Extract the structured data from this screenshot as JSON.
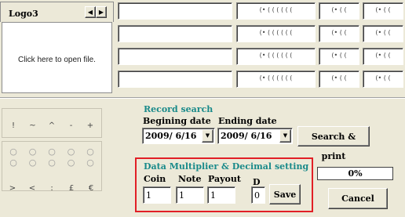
{
  "logo_tab": {
    "label": "Logo3",
    "prev_icon": "caret-left-icon",
    "next_icon": "caret-right-icon",
    "open_file_text": "Click here to open file."
  },
  "file_rows": [
    {
      "value": "",
      "radios_a": "(• ( ( ( ( ( (",
      "radios_b": "(• ( (",
      "radios_c": "(• ( ("
    },
    {
      "value": "",
      "radios_a": "(• ( ( ( ( ( (",
      "radios_b": "(• ( (",
      "radios_c": "(• ( ("
    },
    {
      "value": "",
      "radios_a": "(• ( ( ( ( ( (",
      "radios_b": "(• ( (",
      "radios_c": "(• ( ("
    },
    {
      "value": "",
      "radios_a": "(• ( ( ( ( ( (",
      "radios_b": "(• ( (",
      "radios_c": "(• ( ("
    }
  ],
  "symbols": {
    "row1": [
      "!",
      "~",
      "^",
      "-",
      "+"
    ],
    "row2": [
      "○",
      "○",
      "○",
      "○",
      "○"
    ],
    "row3": [
      "○",
      "○",
      "○",
      "○",
      "○"
    ],
    "row4": [
      ">",
      "<",
      ":",
      "£",
      "€"
    ]
  },
  "record_search": {
    "title": "Record search",
    "begin_label": "Begining date",
    "end_label": "Ending date",
    "begin_value": "2009/ 6/16",
    "end_value": "2009/ 6/16",
    "dropdown_icon": "triangle-down-icon",
    "search_print_label": "Search & print"
  },
  "data_multiplier": {
    "title": "Data Multiplier  &  Decimal setting",
    "coin_label": "Coin",
    "note_label": "Note",
    "payout_label": "Payout",
    "d_label": "D",
    "coin_value": "1",
    "note_value": "1",
    "payout_value": "1",
    "d_value": "0",
    "save_label": "Save",
    "highlight_color": "#e11f26"
  },
  "progress": {
    "text": "0%",
    "percent": 0
  },
  "cancel_label": "Cancel",
  "colors": {
    "background": "#ece9d8",
    "group_title": "#1a8a8a"
  }
}
